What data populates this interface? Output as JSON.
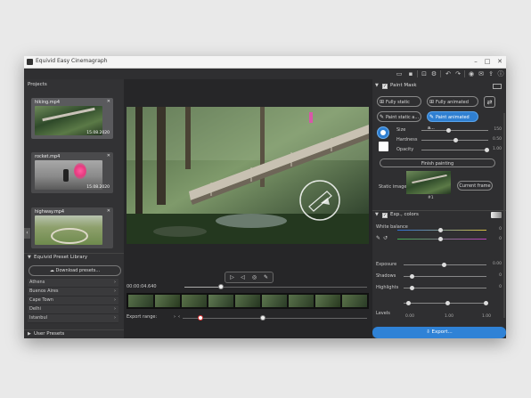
{
  "window": {
    "title": "Equivid Easy Cinemagraph"
  },
  "projects": {
    "title": "Projects",
    "items": [
      {
        "name": "hiking.mp4",
        "date": "15.08.2020"
      },
      {
        "name": "rocket.mp4",
        "date": "15.08.2020"
      },
      {
        "name": "highway.mp4",
        "date": ""
      }
    ]
  },
  "preset_library": {
    "title": "Equivid Preset Library",
    "download_label": "Download presets...",
    "presets": [
      "Athens",
      "Buenos Aires",
      "Cape Town",
      "Delhi",
      "Istanbul"
    ]
  },
  "user_presets": {
    "title": "User Presets"
  },
  "player": {
    "timecode": "00:00:04.640",
    "export_range_label": "Export range:",
    "progress": 0.2
  },
  "paint_mask": {
    "title": "Paint Mask",
    "fully_static": "Fully static",
    "fully_animated": "Fully animated",
    "paint_static": "Paint static a...",
    "paint_animated": "Paint animated a...",
    "size_label": "Size",
    "size_value": "150",
    "hardness_label": "Hardness",
    "hardness_value": "0.50",
    "opacity_label": "Opacity",
    "opacity_value": "1.00",
    "finish_label": "Finish painting",
    "static_image_label": "Static image",
    "static_image_number": "#1",
    "current_frame_label": "Current frame"
  },
  "exp_colors": {
    "title": "Exp., colors",
    "white_balance_label": "White balance",
    "wb_value1": "0",
    "wb_value2": "0",
    "exposure_label": "Exposure",
    "exposure_value": "0.00",
    "shadows_label": "Shadows",
    "shadows_value": "0",
    "highlights_label": "Highlights",
    "highlights_value": "0",
    "levels_label": "Levels",
    "levels_values": [
      "0.00",
      "1.00",
      "1.00"
    ]
  },
  "export": {
    "label": "Export..."
  },
  "colors": {
    "accent": "#2f82d6",
    "background": "#2a2a2c",
    "highlight_knob": "#dd3333"
  }
}
